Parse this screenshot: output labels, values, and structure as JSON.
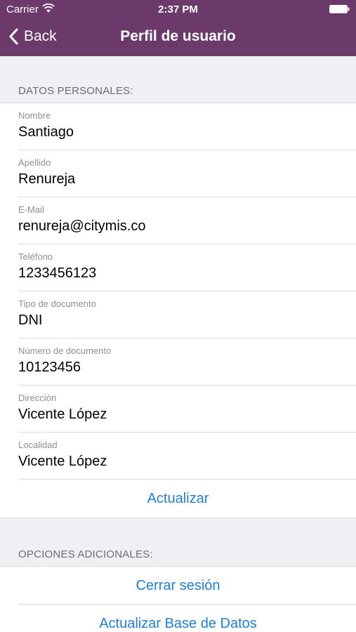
{
  "status_bar": {
    "carrier": "Carrier",
    "time": "2:37 PM"
  },
  "nav": {
    "back_label": "Back",
    "title": "Perfil de usuario",
    "bar_color": "#6b3a6b"
  },
  "personal": {
    "header": "DATOS PERSONALES:",
    "fields": [
      {
        "label": "Nombre",
        "value": "Santiago"
      },
      {
        "label": "Apellido",
        "value": "Renureja"
      },
      {
        "label": "E-Mail",
        "value": "renureja@citymis.co"
      },
      {
        "label": "Teléfono",
        "value": "1233456123"
      },
      {
        "label": "Tipo de documento",
        "value": "DNI"
      },
      {
        "label": "Número de documento",
        "value": "10123456"
      },
      {
        "label": "Dirección",
        "value": "Vicente López"
      },
      {
        "label": "Localidad",
        "value": "Vicente López"
      }
    ],
    "update_button": "Actualizar"
  },
  "additional": {
    "header": "OPCIONES ADICIONALES:",
    "logout_button": "Cerrar sesión",
    "update_db_button": "Actualizar Base de Datos"
  },
  "accent_color": "#1e7ed8"
}
